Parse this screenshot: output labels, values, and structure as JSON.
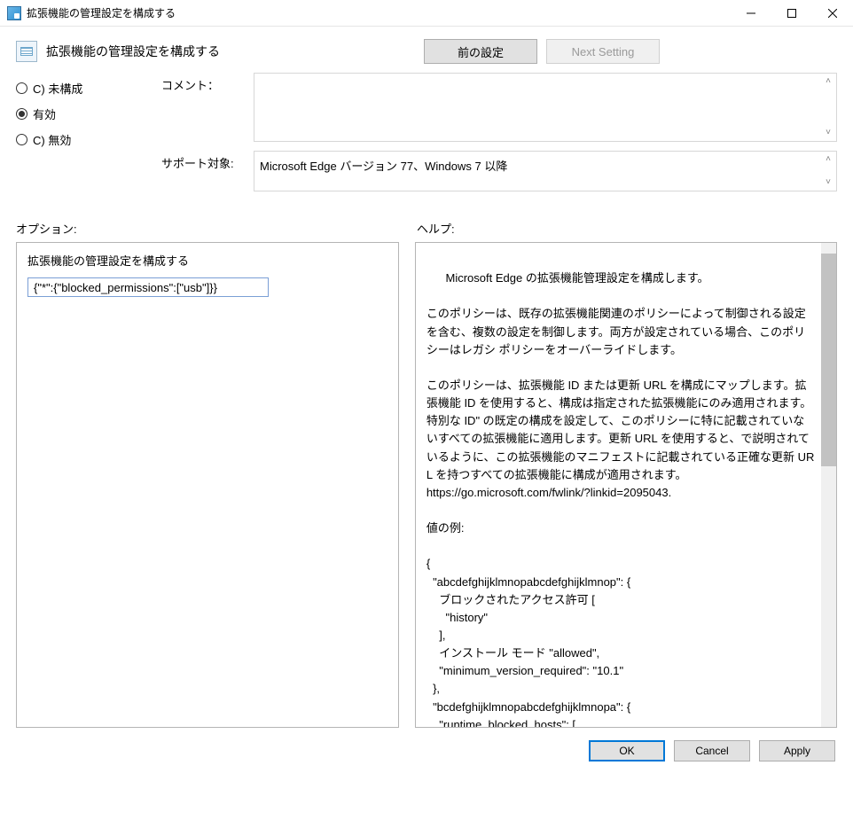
{
  "window": {
    "title": "拡張機能の管理設定を構成する"
  },
  "header": {
    "title": "拡張機能の管理設定を構成する",
    "prev_label": "前の設定",
    "next_label": "Next Setting"
  },
  "radios": {
    "not_configured": "C) 未構成",
    "enabled": "有効",
    "disabled": "C) 無効",
    "selected": "enabled"
  },
  "labels": {
    "comment": "コメント：",
    "supported": "サポート対象:",
    "options": "オプション:",
    "help": "ヘルプ:"
  },
  "comment_value": "",
  "supported_value": "Microsoft Edge バージョン 77、Windows 7 以降",
  "options_panel": {
    "field_label": "拡張機能の管理設定を構成する",
    "field_value": "{\"*\":{\"blocked_permissions\":[\"usb\"]}}"
  },
  "help_text": "Microsoft Edge の拡張機能管理設定を構成します。\n\nこのポリシーは、既存の拡張機能関連のポリシーによって制御される設定を含む、複数の設定を制御します。両方が設定されている場合、このポリシーはレガシ ポリシーをオーバーライドします。\n\nこのポリシーは、拡張機能 ID または更新 URL を構成にマップします。拡張機能 ID を使用すると、構成は指定された拡張機能にのみ適用されます。特別な ID\" の既定の構成を設定して、このポリシーに特に記載されていないすべての拡張機能に適用します。更新 URL を使用すると、で説明されているように、この拡張機能のマニフェストに記載されている正確な更新 URL を持つすべての拡張機能に構成が適用されます。\nhttps://go.microsoft.com/fwlink/?linkid=2095043.\n\n値の例:\n\n{\n  \"abcdefghijklmnopabcdefghijklmnop\": {\n    ブロックされたアクセス許可 [\n      \"history\"\n    ],\n    インストール モード \"allowed\",\n    \"minimum_version_required\": \"10.1\"\n  },\n  \"bcdefghijklmnopabcdefghijklmnopa\": {\n    \"runtime_blocked_hosts\": [\n      \"*://*.contoso.com\"",
  "footer": {
    "ok": "OK",
    "cancel": "Cancel",
    "apply": "Apply"
  }
}
